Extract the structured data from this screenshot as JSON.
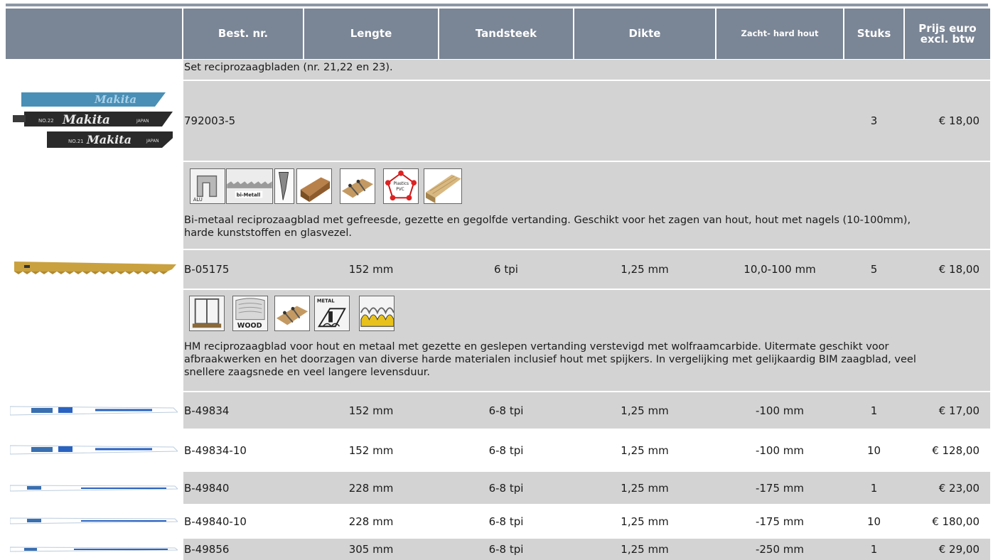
{
  "header": {
    "best_nr": "Best. nr.",
    "lengte": "Lengte",
    "tandsteek": "Tandsteek",
    "dikte": "Dikte",
    "zacht_hard": "Zacht- hard hout",
    "stuks": "Stuks",
    "prijs_line1": "Prijs euro",
    "prijs_line2": "excl. btw"
  },
  "section1": {
    "title": "Set reciprozaagbladen (nr. 21,22 en 23).",
    "blade_labels": [
      "Makita",
      "NO.22",
      "Makita",
      "JAPAN",
      "NO.21",
      "Makita",
      "JAPAN"
    ],
    "row": {
      "best_nr": "792003-5",
      "stuks": "3",
      "prijs": "€ 18,00"
    }
  },
  "section2": {
    "icons": [
      "alu-icon",
      "bi-metal-icon",
      "blade-profile-icon",
      "wood-icon",
      "wood-nails-icon",
      "plastics-pvc-icon",
      "wood-board-icon"
    ],
    "icon_labels": {
      "alu": "ALU",
      "bimetal": "bi-Metall",
      "plastics": "Plastics",
      "pvc": "PVC"
    },
    "description_line1": "Bi-metaal reciprozaagblad met gefreesde, gezette en gegolfde vertanding. Geschikt voor het zagen van hout, hout met nagels (10-100mm),",
    "description_line2": "harde kunststoffen en glasvezel.",
    "row": {
      "best_nr": "B-05175",
      "lengte": "152 mm",
      "tandsteek": "6 tpi",
      "dikte": "1,25 mm",
      "zacht_hard": "10,0-100 mm",
      "stuks": "5",
      "prijs": "€ 18,00"
    }
  },
  "section3": {
    "icons": [
      "window-frame-icon",
      "wood-icon",
      "wood-nails-icon",
      "metal-profile-icon",
      "corrugated-sheet-icon"
    ],
    "icon_labels": {
      "wood": "WOOD",
      "metal": "METAL"
    },
    "description_line1": "HM reciprozaagblad voor hout en metaal met gezette en geslepen vertanding verstevigd met wolfraamcarbide. Uitermate geschikt voor",
    "description_line2": "afbraakwerken en het doorzagen van diverse harde materialen inclusief hout met spijkers. In vergelijking met gelijkaardig BIM zaagblad, veel",
    "description_line3": "snellere zaagsnede en veel langere levensduur.",
    "rows": [
      {
        "best_nr": "B-49834",
        "lengte": "152 mm",
        "tandsteek": "6-8 tpi",
        "dikte": "1,25 mm",
        "zacht_hard": "-100 mm",
        "stuks": "1",
        "prijs": "€ 17,00"
      },
      {
        "best_nr": "B-49834-10",
        "lengte": "152 mm",
        "tandsteek": "6-8 tpi",
        "dikte": "1,25 mm",
        "zacht_hard": "-100 mm",
        "stuks": "10",
        "prijs": "€ 128,00"
      },
      {
        "best_nr": "B-49840",
        "lengte": "228 mm",
        "tandsteek": "6-8 tpi",
        "dikte": "1,25 mm",
        "zacht_hard": "-175 mm",
        "stuks": "1",
        "prijs": "€ 23,00"
      },
      {
        "best_nr": "B-49840-10",
        "lengte": "228 mm",
        "tandsteek": "6-8 tpi",
        "dikte": "1,25 mm",
        "zacht_hard": "-175 mm",
        "stuks": "10",
        "prijs": "€ 180,00"
      },
      {
        "best_nr": "B-49856",
        "lengte": "305 mm",
        "tandsteek": "6-8 tpi",
        "dikte": "1,25 mm",
        "zacht_hard": "-250 mm",
        "stuks": "1",
        "prijs": "€ 29,00"
      }
    ]
  },
  "colors": {
    "header_bg": "#7a8595",
    "row_gray": "#d3d3d3",
    "top_rule": "#8d97a6"
  }
}
